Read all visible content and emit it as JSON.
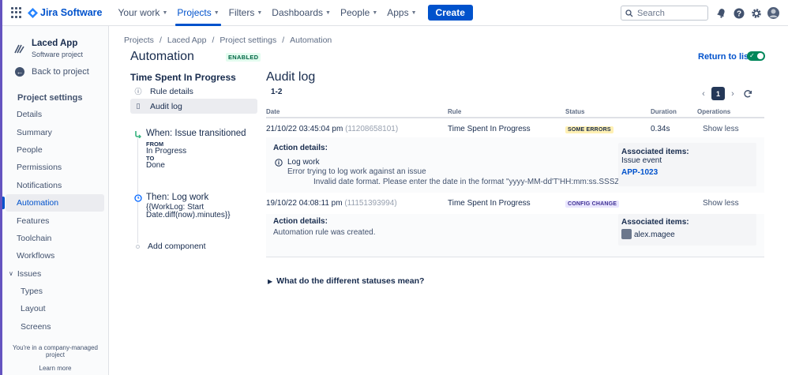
{
  "topnav": {
    "logo_text": "Jira Software",
    "items": [
      {
        "label": "Your work",
        "active": false
      },
      {
        "label": "Projects",
        "active": true
      },
      {
        "label": "Filters",
        "active": false
      },
      {
        "label": "Dashboards",
        "active": false
      },
      {
        "label": "People",
        "active": false
      },
      {
        "label": "Apps",
        "active": false
      }
    ],
    "create_label": "Create",
    "search_placeholder": "Search",
    "icons": [
      "notifications-icon",
      "help-icon",
      "settings-icon",
      "profile-avatar"
    ]
  },
  "sidebar": {
    "project_name": "Laced App",
    "project_type": "Software project",
    "back_label": "Back to project",
    "section_title": "Project settings",
    "items": [
      {
        "label": "Details"
      },
      {
        "label": "Summary"
      },
      {
        "label": "People"
      },
      {
        "label": "Permissions"
      },
      {
        "label": "Notifications"
      },
      {
        "label": "Automation",
        "active": true
      },
      {
        "label": "Features"
      },
      {
        "label": "Toolchain"
      },
      {
        "label": "Workflows"
      },
      {
        "label": "Issues",
        "expandable": true
      },
      {
        "label": "Types",
        "sub": true
      },
      {
        "label": "Layout",
        "sub": true
      },
      {
        "label": "Screens",
        "sub": true
      }
    ],
    "footer_text": "You're in a company-managed project",
    "footer_link": "Learn more"
  },
  "breadcrumb": [
    "Projects",
    "Laced App",
    "Project settings",
    "Automation"
  ],
  "page": {
    "title": "Automation",
    "status_badge": "ENABLED",
    "return_link": "Return to list"
  },
  "rule": {
    "title": "Time Spent In Progress",
    "nav": [
      {
        "label": "Rule details",
        "icon": "info-icon"
      },
      {
        "label": "Audit log",
        "icon": "document-icon",
        "active": true
      }
    ],
    "trigger": {
      "title": "When: Issue transitioned",
      "from_label": "FROM",
      "from_value": "In Progress",
      "to_label": "TO",
      "to_value": "Done"
    },
    "action": {
      "title": "Then: Log work",
      "line1": "{{WorkLog: Start",
      "line2": "Date.diff(now).minutes}}"
    },
    "add_component": "Add component"
  },
  "audit": {
    "title": "Audit log",
    "range": "1-2",
    "current_page": "1",
    "columns": [
      "Date",
      "Rule",
      "Status",
      "Duration",
      "Operations"
    ],
    "rows": [
      {
        "date": "21/10/22 03:45:04 pm",
        "id": "(11208658101)",
        "rule": "Time Spent In Progress",
        "status": "SOME ERRORS",
        "duration": "0.34s",
        "operation": "Show less",
        "details_label": "Action details:",
        "detail_title": "Log work",
        "detail_line1": "Error trying to log work against an issue",
        "detail_line2": "Invalid date format. Please enter the date in the format \"yyyy-MM-dd'T'HH:mm:ss.SSSZ\". (started)",
        "assoc_label": "Associated items:",
        "assoc_sub": "Issue event",
        "assoc_link": "APP-1023"
      },
      {
        "date": "19/10/22 04:08:11 pm",
        "id": "(11151393994)",
        "rule": "Time Spent In Progress",
        "status": "CONFIG CHANGE",
        "duration": "",
        "operation": "Show less",
        "details_label": "Action details:",
        "detail_line1": "Automation rule was created.",
        "assoc_label": "Associated items:",
        "assoc_user": "alex.magee"
      }
    ],
    "faq": "What do the different statuses mean?"
  }
}
